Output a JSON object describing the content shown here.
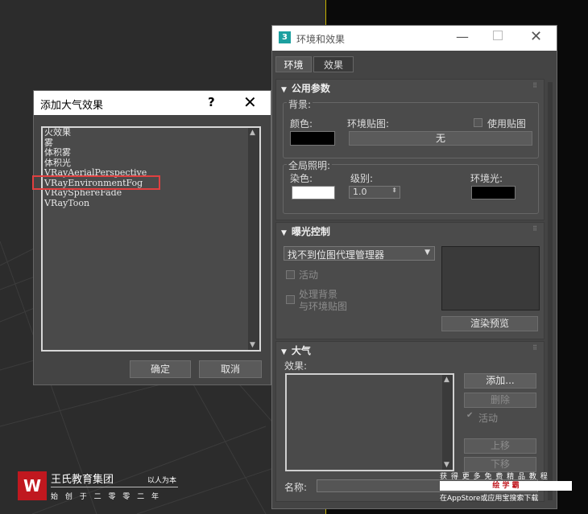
{
  "add_dialog": {
    "title": "添加大气效果",
    "help": "?",
    "close": "✕",
    "items": [
      "火效果",
      "雾",
      "体积雾",
      "体积光",
      "VRayAerialPerspective",
      "VRayEnvironmentFog",
      "VRaySphereFade",
      "VRayToon"
    ],
    "ok": "确定",
    "cancel": "取消"
  },
  "env_window": {
    "title": "环境和效果",
    "app_icon": "3",
    "minimize": "—",
    "close": "✕",
    "tabs": [
      "环境",
      "效果"
    ],
    "common": {
      "header": "公用参数",
      "background_group": "背景:",
      "color_label": "颜色:",
      "env_map_label": "环境贴图:",
      "use_map_label": "使用贴图",
      "map_button": "无",
      "global_group": "全局照明:",
      "tint_label": "染色:",
      "level_label": "级别:",
      "level_value": "1.0",
      "ambient_label": "环境光:"
    },
    "exposure": {
      "header": "曝光控制",
      "dropdown_value": "找不到位图代理管理器",
      "active_label": "活动",
      "process_bg_line1": "处理背景",
      "process_bg_line2": "与环境贴图",
      "render_preview": "渲染预览"
    },
    "atmosphere": {
      "header": "大气",
      "effects_label": "效果:",
      "add": "添加...",
      "delete": "删除",
      "active_label": "活动",
      "move_up": "上移",
      "move_down": "下移",
      "name_label": "名称:"
    }
  },
  "watermark": {
    "logo_letter": "W",
    "name": "王氏教育集团",
    "motto": "以人为本",
    "year": "始 创 于 二 零 零 二 年",
    "promo_line1": "获 得 更 多 免 费 精 品 教 程",
    "promo_line2": "绘 学 霸",
    "promo_line3": "在AppStore或应用宝搜索下载"
  },
  "colors": {
    "accent_red": "#e04040",
    "title_bar": "#ffffff",
    "panel": "#444444"
  }
}
